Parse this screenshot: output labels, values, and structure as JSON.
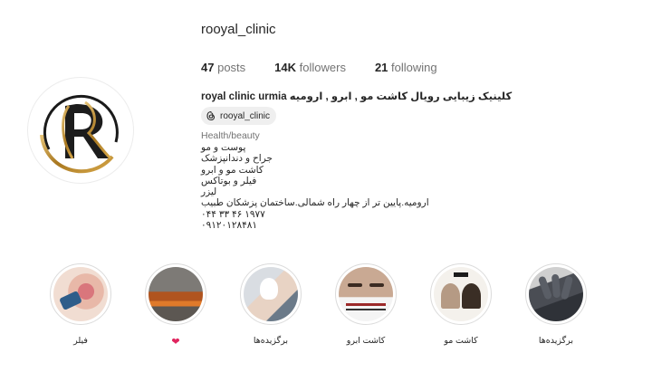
{
  "profile": {
    "username": "rooyal_clinic",
    "stats": {
      "posts_count": "47",
      "posts_label": "posts",
      "followers_count": "14K",
      "followers_label": "followers",
      "following_count": "21",
      "following_label": "following"
    },
    "full_name": "royal clinic urmia کلینیک زیبایی رویال کاشت مو , ابرو , ارومیه",
    "threads_handle": "rooyal_clinic",
    "category": "Health/beauty",
    "bio_lines": [
      "پوست و مو",
      "جراح و دندانپزشک",
      "کاشت مو و ابرو",
      "فیلر و بوتاکس",
      "لیزر",
      "ارومیه.پایین تر از چهار راه شمالی.ساختمان پزشکان طبیب",
      "۰۴۴ ۳۳ ۴۶ ۱۹۷۷",
      "۰۹۱۲۰۱۲۸۴۸۱"
    ],
    "avatar_icon": "royal-clinic-logo-icon",
    "brand_gold": "#b8862b"
  },
  "highlights": [
    {
      "label": "فیلر",
      "icon": "lips-thumbnail"
    },
    {
      "label": "",
      "icon": "heart-icon",
      "glyph": "❤",
      "color": "#e0245e"
    },
    {
      "label": "برگزیده‌ها",
      "icon": "treatment-thumbnail"
    },
    {
      "label": "کاشت ابرو",
      "icon": "eyebrow-thumbnail"
    },
    {
      "label": "کاشت مو",
      "icon": "hair-transplant-thumbnail"
    },
    {
      "label": "برگزیده‌ها",
      "icon": "gloves-thumbnail"
    }
  ]
}
